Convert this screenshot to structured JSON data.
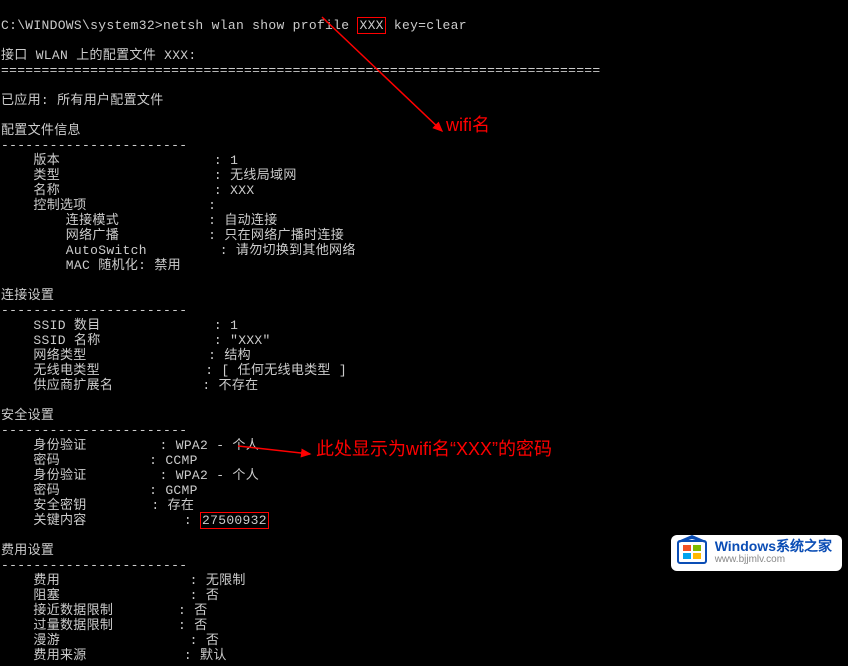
{
  "cmd": {
    "prompt": "C:\\WINDOWS\\system32>",
    "command_pre": "netsh wlan show profile ",
    "profile_arg": "XXX",
    "command_post": " key=clear"
  },
  "lines": {
    "header": "接口 WLAN 上的配置文件 XXX:",
    "header_underline": "==========================================================================",
    "applied": "已应用: 所有用户配置文件",
    "section_profile": "配置文件信息",
    "section_conn": "连接设置",
    "section_sec": "安全设置",
    "section_cost": "费用设置",
    "section_dash": "-----------------------",
    "rows": {
      "version": "    版本                   : 1",
      "type": "    类型                   : 无线局域网",
      "name": "    名称                   : XXX",
      "ctrl": "    控制选项               :",
      "connmode": "        连接模式           : 自动连接",
      "broadcast": "        网络广播           : 只在网络广播时连接",
      "autoswitch": "        AutoSwitch         : 请勿切换到其他网络",
      "macrand": "        MAC 随机化: 禁用",
      "ssidnum": "    SSID 数目              : 1",
      "ssidname": "    SSID 名称              : \"XXX\"",
      "nettype": "    网络类型               : 结构",
      "radiotype": "    无线电类型             : [ 任何无线电类型 ]",
      "vendor": "    供应商扩展名           : 不存在",
      "auth1": "    身份验证         : WPA2 - 个人",
      "cipher1": "    密码           : CCMP",
      "auth2": "    身份验证         : WPA2 - 个人",
      "cipher2": "    密码           : GCMP",
      "seckey": "    安全密钥        : 存在",
      "keycontent_l": "    关键内容            : ",
      "keycontent_v": "27500932",
      "cost": "    费用                : 无限制",
      "congested": "    阻塞                : 否",
      "approach": "    接近数据限制        : 否",
      "over": "    过量数据限制        : 否",
      "roaming": "    漫游                : 否",
      "costsource": "    费用来源            : 默认"
    }
  },
  "annotations": {
    "wifi_name_label": "wifi名",
    "password_label": "此处显示为wifi名“XXX”的密码"
  },
  "watermark": {
    "title": "Windows系统之家",
    "url": "www.bjjmlv.com"
  }
}
